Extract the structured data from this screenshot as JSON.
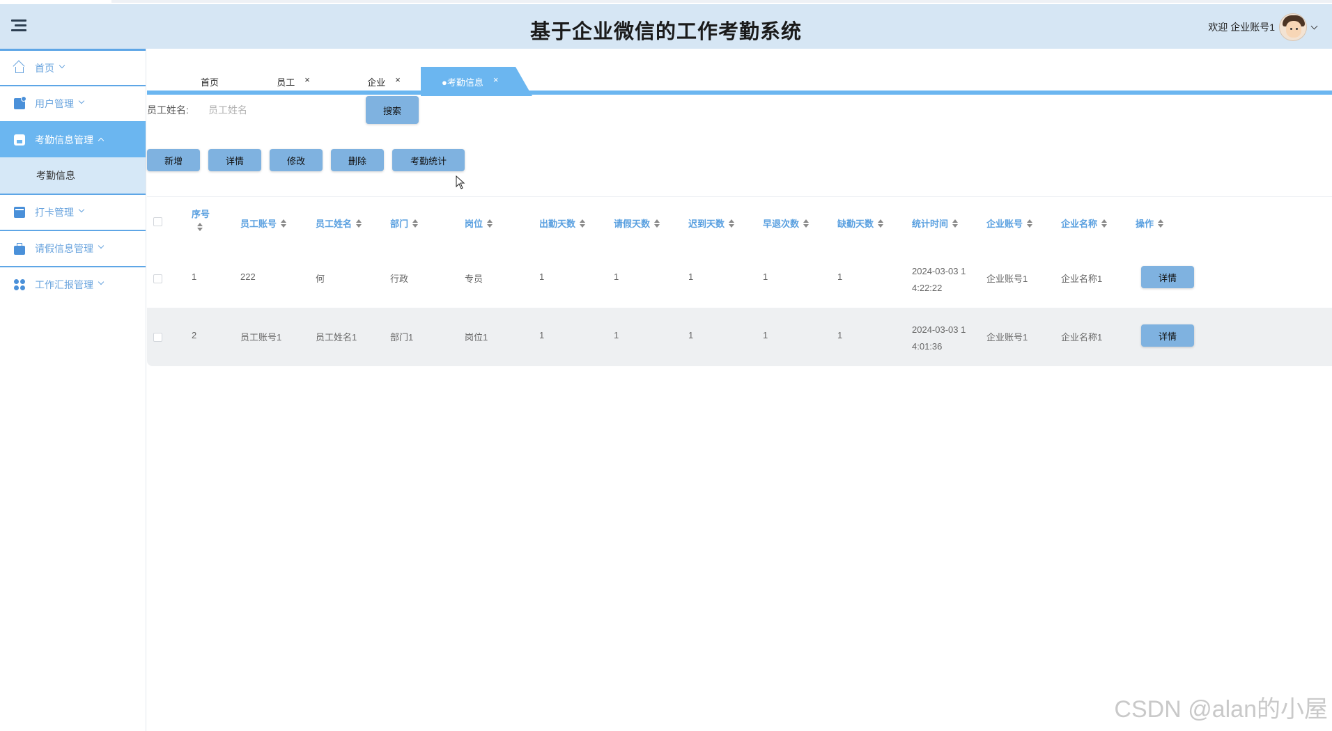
{
  "header": {
    "title": "基于企业微信的工作考勤系统",
    "welcome": "欢迎 企业账号1"
  },
  "sidebar": {
    "items": [
      {
        "label": "首页",
        "icon": "home-icon"
      },
      {
        "label": "用户管理",
        "icon": "user-manage-icon"
      },
      {
        "label": "考勤信息管理",
        "icon": "attendance-icon",
        "active": true
      },
      {
        "label": "打卡管理",
        "icon": "clock-in-icon"
      },
      {
        "label": "请假信息管理",
        "icon": "leave-icon"
      },
      {
        "label": "工作汇报管理",
        "icon": "report-icon"
      }
    ],
    "sub_item": "考勤信息"
  },
  "tabs": [
    {
      "label": "首页",
      "closable": false
    },
    {
      "label": "员工",
      "closable": true
    },
    {
      "label": "企业",
      "closable": true
    },
    {
      "label": "●考勤信息",
      "closable": true,
      "active": true
    }
  ],
  "close_glyph": "×",
  "search": {
    "label": "员工姓名:",
    "placeholder": "员工姓名",
    "button": "搜索"
  },
  "actions": [
    "新增",
    "详情",
    "修改",
    "删除",
    "考勤统计"
  ],
  "table": {
    "columns": [
      "序号",
      "员工账号",
      "员工姓名",
      "部门",
      "岗位",
      "出勤天数",
      "请假天数",
      "迟到天数",
      "早退次数",
      "缺勤天数",
      "统计时间",
      "企业账号",
      "企业名称",
      "操作"
    ],
    "rows": [
      {
        "no": "1",
        "account": "222",
        "name": "何",
        "dept": "行政",
        "post": "专员",
        "attend": "1",
        "leave": "1",
        "late": "1",
        "early": "1",
        "absent": "1",
        "time1": "2024-03-03 1",
        "time2": "4:22:22",
        "corp_account": "企业账号1",
        "corp_name": "企业名称1",
        "op": "详情"
      },
      {
        "no": "2",
        "account": "员工账号1",
        "name": "员工姓名1",
        "dept": "部门1",
        "post": "岗位1",
        "attend": "1",
        "leave": "1",
        "late": "1",
        "early": "1",
        "absent": "1",
        "time1": "2024-03-03 1",
        "time2": "4:01:36",
        "corp_account": "企业账号1",
        "corp_name": "企业名称1",
        "op": "详情"
      }
    ]
  },
  "watermark": "CSDN @alan的小屋",
  "colors": {
    "header_bg": "#d6e6f4",
    "accent": "#6bb6f0",
    "button": "#7fb2e0",
    "header_text": "#5aa0e0"
  }
}
